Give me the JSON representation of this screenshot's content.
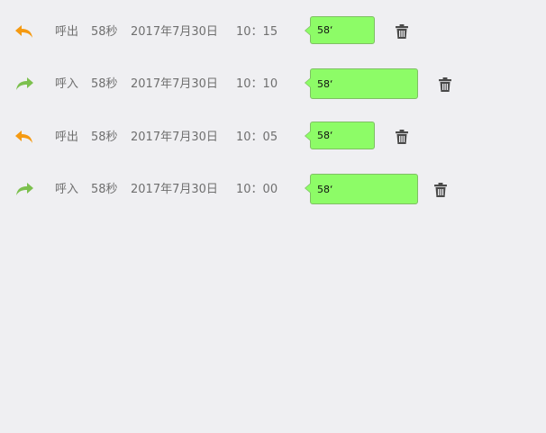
{
  "records": [
    {
      "direction": "out",
      "direction_icon": "reply-arrow-icon",
      "type": "呼出",
      "duration": "58秒",
      "date": "2017年7月30日",
      "time": "10：15",
      "bubble": "58‘",
      "icon_color": "#f59a12"
    },
    {
      "direction": "in",
      "direction_icon": "forward-arrow-icon",
      "type": "呼入",
      "duration": "58秒",
      "date": "2017年7月30日",
      "time": "10：10",
      "bubble": "58‘",
      "icon_color": "#7cc04e"
    },
    {
      "direction": "out",
      "direction_icon": "reply-arrow-icon",
      "type": "呼出",
      "duration": "58秒",
      "date": "2017年7月30日",
      "time": "10：05",
      "bubble": "58‘",
      "icon_color": "#f59a12"
    },
    {
      "direction": "in",
      "direction_icon": "forward-arrow-icon",
      "type": "呼入",
      "duration": "58秒",
      "date": "2017年7月30日",
      "time": "10：00",
      "bubble": "58‘",
      "icon_color": "#7cc04e"
    }
  ],
  "colors": {
    "background": "#efeff2",
    "bubble_fill": "#8dfc67",
    "bubble_border": "#7fbf64",
    "text": "#6f6f6f",
    "trash": "#4a4a4a"
  }
}
